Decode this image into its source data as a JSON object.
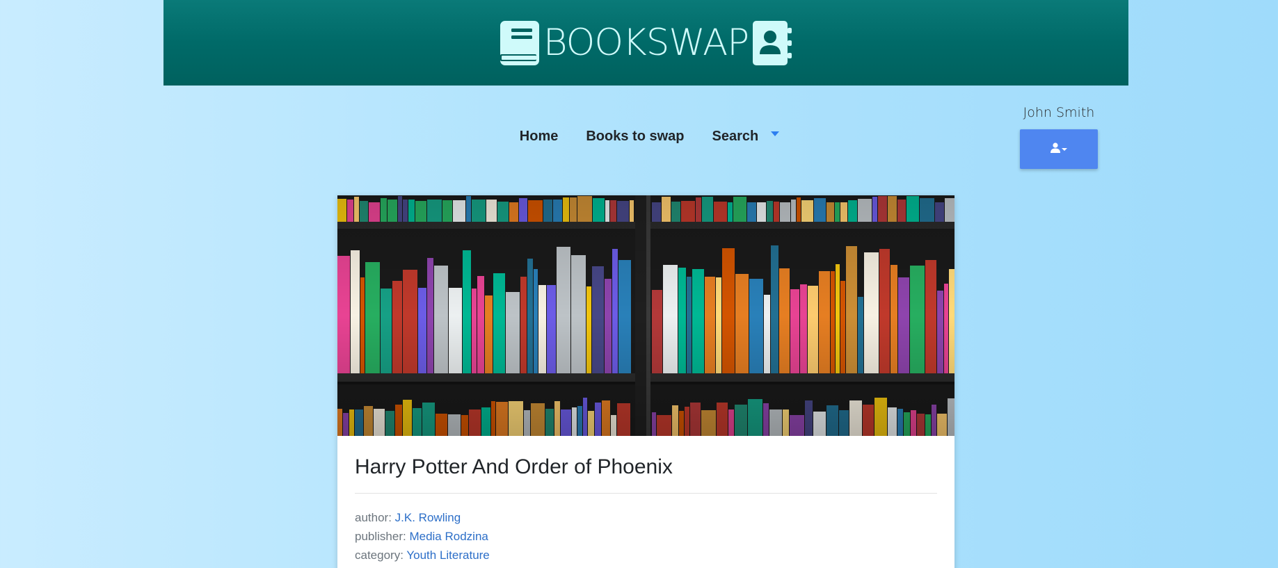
{
  "brand": {
    "title": "BOOKSWAP",
    "left_icon": "book-icon",
    "right_icon": "address-book-icon"
  },
  "nav": {
    "items": [
      {
        "label": "Home"
      },
      {
        "label": "Books to swap"
      },
      {
        "label": "Search",
        "icon": "caret-down-icon"
      }
    ]
  },
  "user": {
    "name": "John Smith",
    "button_icon": "user-icon"
  },
  "book": {
    "title": "Harry Potter And Order of Phoenix",
    "image": "bookshelf-photo",
    "fields": [
      {
        "label": "author:",
        "value": "J.K. Rowling"
      },
      {
        "label": "publisher:",
        "value": "Media Rodzina"
      },
      {
        "label": "category:",
        "value": "Youth Literature"
      }
    ]
  },
  "colors": {
    "header_bg": "#006a68",
    "logo_text": "#cffafa",
    "accent": "#4f86f0",
    "link": "#2d6fc8"
  }
}
